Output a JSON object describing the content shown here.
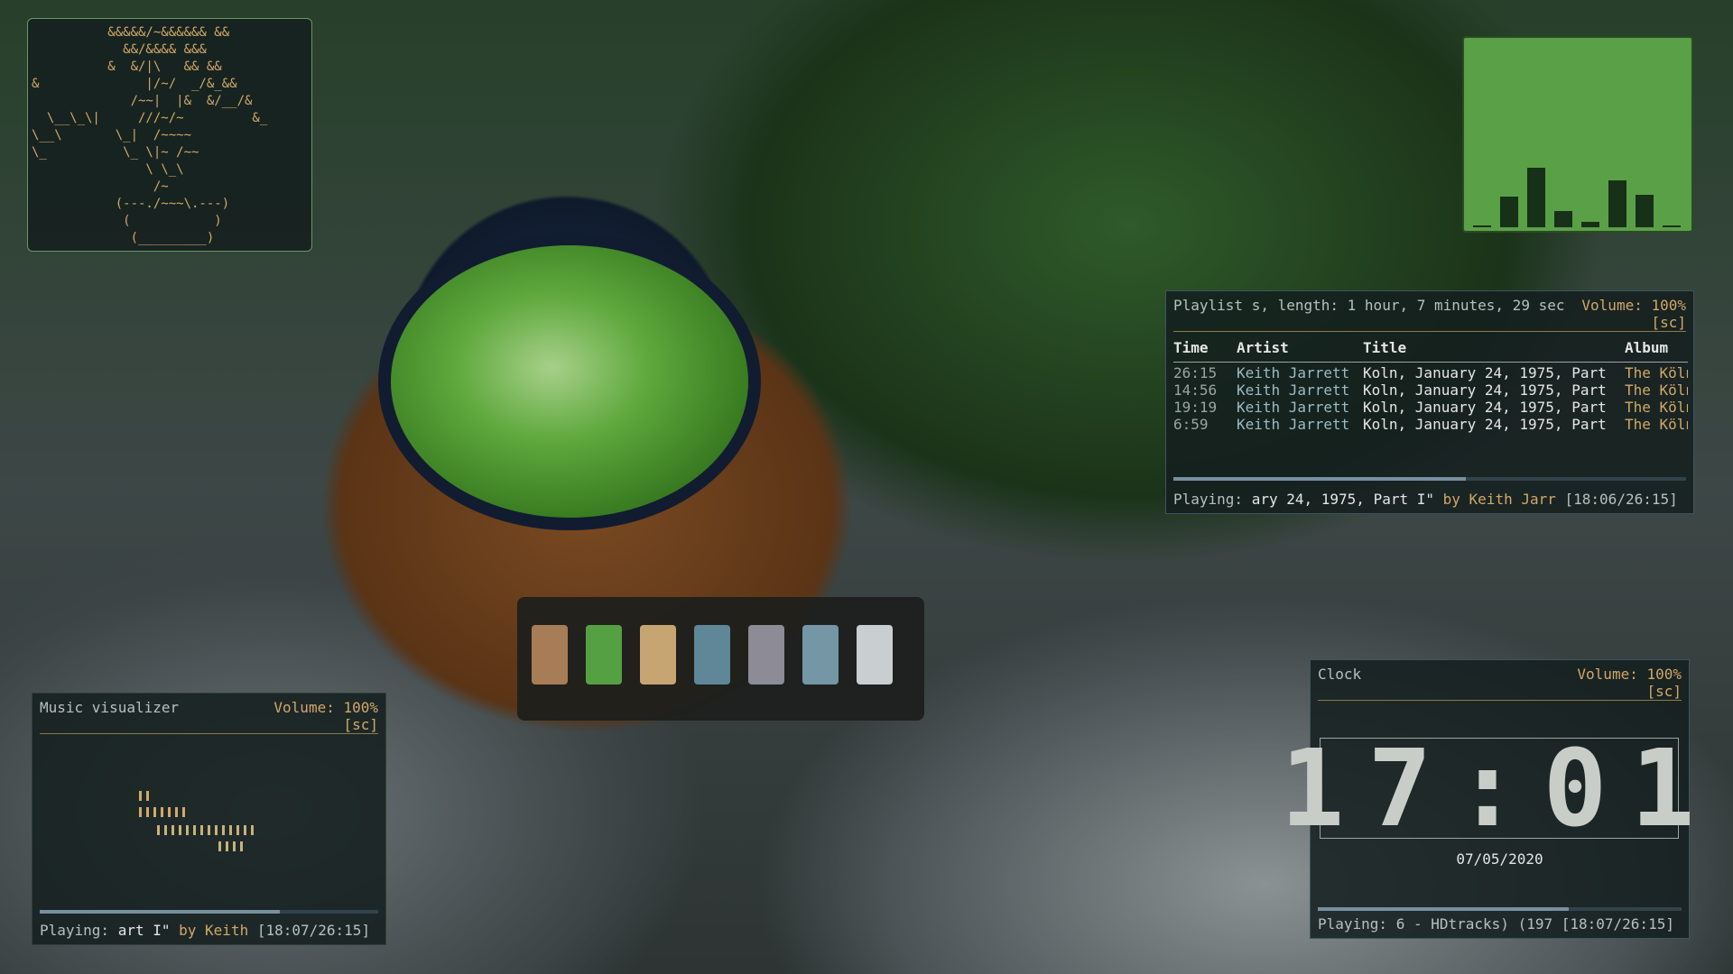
{
  "ascii_widget": {
    "art": "          &&&&&/~&&&&&& &&\n            &&/&&&& &&&\n          &  &/|\\   && &&\n&              |/~/  _/&_&&\n             /~~|  |&  &/__/&\n  \\__\\_\\|     ///~/~         &_\n\\__\\       \\_|  /~~~~\n\\_          \\_ \\|~ /~~\n               \\ \\_\\\n                /~\n           (---./~~~\\.---)\n            (           )\n             (_________)"
  },
  "bars_widget": {
    "values": [
      0,
      0.17,
      0.33,
      0.09,
      0.03,
      0.26,
      0.18,
      0.01
    ],
    "colors": {
      "background": "#5aa047",
      "bar": "#173018"
    }
  },
  "playlist": {
    "header_text": "Playlist s, length: 1 hour, 7 minutes, 29 sec",
    "volume": "Volume: 100%",
    "screen_tag": "[sc]",
    "columns": [
      "Time",
      "Artist",
      "Title",
      "Album"
    ],
    "rows": [
      {
        "time": "26:15",
        "artist": "Keith Jarrett",
        "title": "Koln, January 24, 1975, Part",
        "album": "The Köln"
      },
      {
        "time": "14:56",
        "artist": "Keith Jarrett",
        "title": "Koln, January 24, 1975, Part",
        "album": "The Köln"
      },
      {
        "time": "19:19",
        "artist": "Keith Jarrett",
        "title": "Koln, January 24, 1975, Part",
        "album": "The Köln"
      },
      {
        "time": "6:59",
        "artist": "Keith Jarrett",
        "title": "Koln, January 24, 1975, Part",
        "album": "The Köln"
      }
    ],
    "progress": 0.57,
    "playing_label": "Playing:",
    "playing_title": "ary 24, 1975, Part I\"",
    "playing_by": "by Keith Jarr",
    "playing_time": "[18:06/26:15]"
  },
  "palette": {
    "colors": [
      "#a67d57",
      "#56a044",
      "#c7a572",
      "#5f8798",
      "#8d8b95",
      "#7596a4",
      "#c9ced0"
    ]
  },
  "visualizer": {
    "title": "Music visualizer",
    "volume": "Volume: 100%",
    "screen_tag": "[sc]",
    "progress": 0.71,
    "playing_label": "Playing:",
    "playing_title": "art I\"",
    "playing_by": "by Keith",
    "playing_time": "[18:07/26:15]"
  },
  "clock": {
    "title": "Clock",
    "volume": "Volume: 100%",
    "screen_tag": "[sc]",
    "time": "17:01",
    "date": "07/05/2020",
    "progress": 0.69,
    "playing_label": "Playing:",
    "playing_title": "6 - HDtracks) (197",
    "playing_time": "[18:07/26:15]"
  }
}
